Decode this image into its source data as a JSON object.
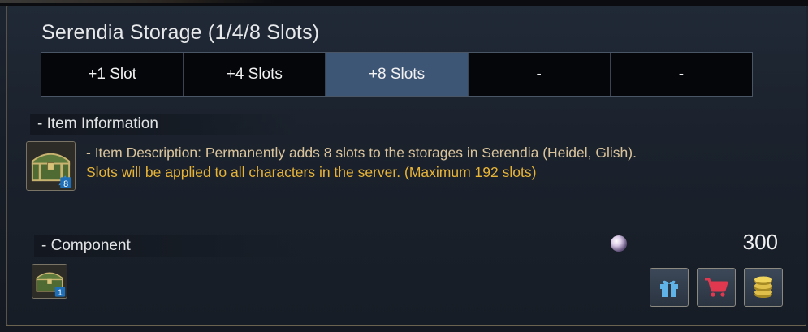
{
  "title": "Serendia Storage (1/4/8 Slots)",
  "tabs": [
    {
      "label": "+1 Slot",
      "active": false
    },
    {
      "label": "+4 Slots",
      "active": false
    },
    {
      "label": "+8 Slots",
      "active": true
    },
    {
      "label": "-",
      "active": false
    },
    {
      "label": "-",
      "active": false
    }
  ],
  "item_info": {
    "heading": "- Item Information",
    "icon": "storage-chest-icon",
    "icon_badge": "8",
    "description_line1": "- Item Description: Permanently adds 8 slots to the storages in Serendia (Heidel, Glish).",
    "description_line2": "Slots will be applied to all characters in the server. (Maximum 192 slots)"
  },
  "component": {
    "heading": "- Component",
    "icon": "storage-chest-icon",
    "icon_badge": "1"
  },
  "price": {
    "currency_icon": "pearl-icon",
    "amount": "300"
  },
  "actions": [
    {
      "icon": "gift-icon"
    },
    {
      "icon": "cart-icon"
    },
    {
      "icon": "coins-icon"
    }
  ],
  "colors": {
    "active_tab": "#3e5675",
    "description_text": "#d9c39c",
    "highlight_text": "#e8b437",
    "panel_border": "#5a5448"
  }
}
